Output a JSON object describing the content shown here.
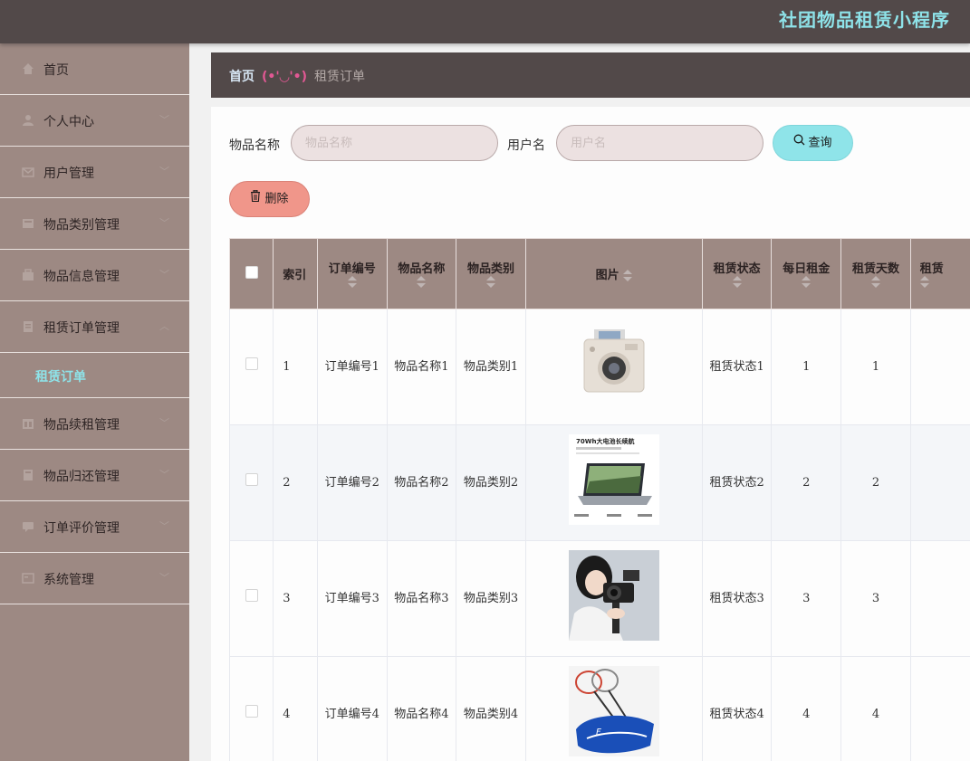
{
  "app": {
    "title": "社团物品租赁小程序"
  },
  "sidebar": {
    "items": [
      {
        "label": "首页",
        "icon": "home-icon",
        "chevron": false
      },
      {
        "label": "个人中心",
        "icon": "user-icon",
        "chevron": true
      },
      {
        "label": "用户管理",
        "icon": "mail-icon",
        "chevron": true
      },
      {
        "label": "物品类别管理",
        "icon": "category-icon",
        "chevron": true
      },
      {
        "label": "物品信息管理",
        "icon": "box-icon",
        "chevron": true
      },
      {
        "label": "租赁订单管理",
        "icon": "order-icon",
        "chevron": true,
        "expanded": true
      },
      {
        "label": "物品续租管理",
        "icon": "renew-icon",
        "chevron": true
      },
      {
        "label": "物品归还管理",
        "icon": "return-icon",
        "chevron": true
      },
      {
        "label": "订单评价管理",
        "icon": "comment-icon",
        "chevron": true
      },
      {
        "label": "系统管理",
        "icon": "settings-icon",
        "chevron": true
      }
    ],
    "submenu": {
      "label": "租赁订单"
    }
  },
  "breadcrumb": {
    "home": "首页",
    "separator": "(•'◡'•)",
    "current": "租赁订单"
  },
  "search": {
    "item_name_label": "物品名称",
    "item_name_placeholder": "物品名称",
    "username_label": "用户名",
    "username_placeholder": "用户名",
    "query_button": "查询"
  },
  "actions": {
    "delete_button": "删除"
  },
  "table": {
    "columns": [
      "索引",
      "订单编号",
      "物品名称",
      "物品类别",
      "图片",
      "租赁状态",
      "每日租金",
      "租赁天数",
      "租赁"
    ],
    "rows": [
      {
        "index": "1",
        "order_no": "订单编号1",
        "item_name": "物品名称1",
        "item_category": "物品类别1",
        "image": "instant-camera",
        "status": "租赁状态1",
        "daily_rent": "1",
        "days": "1"
      },
      {
        "index": "2",
        "order_no": "订单编号2",
        "item_name": "物品名称2",
        "item_category": "物品类别2",
        "image": "laptop",
        "status": "租赁状态2",
        "daily_rent": "2",
        "days": "2"
      },
      {
        "index": "3",
        "order_no": "订单编号3",
        "item_name": "物品名称3",
        "item_category": "物品类别3",
        "image": "vlog-camera",
        "status": "租赁状态3",
        "daily_rent": "3",
        "days": "3"
      },
      {
        "index": "4",
        "order_no": "订单编号4",
        "item_name": "物品名称4",
        "item_category": "物品类别4",
        "image": "badminton-set",
        "status": "租赁状态4",
        "daily_rent": "4",
        "days": "4"
      }
    ],
    "laptop_ad_text": "70Wh大电池长续航"
  },
  "colors": {
    "topbar": "#524949",
    "sidebar": "#9d8983",
    "accent": "#8ee3e9",
    "delete": "#f0968a",
    "breadcrumb_sep": "#e25894"
  }
}
